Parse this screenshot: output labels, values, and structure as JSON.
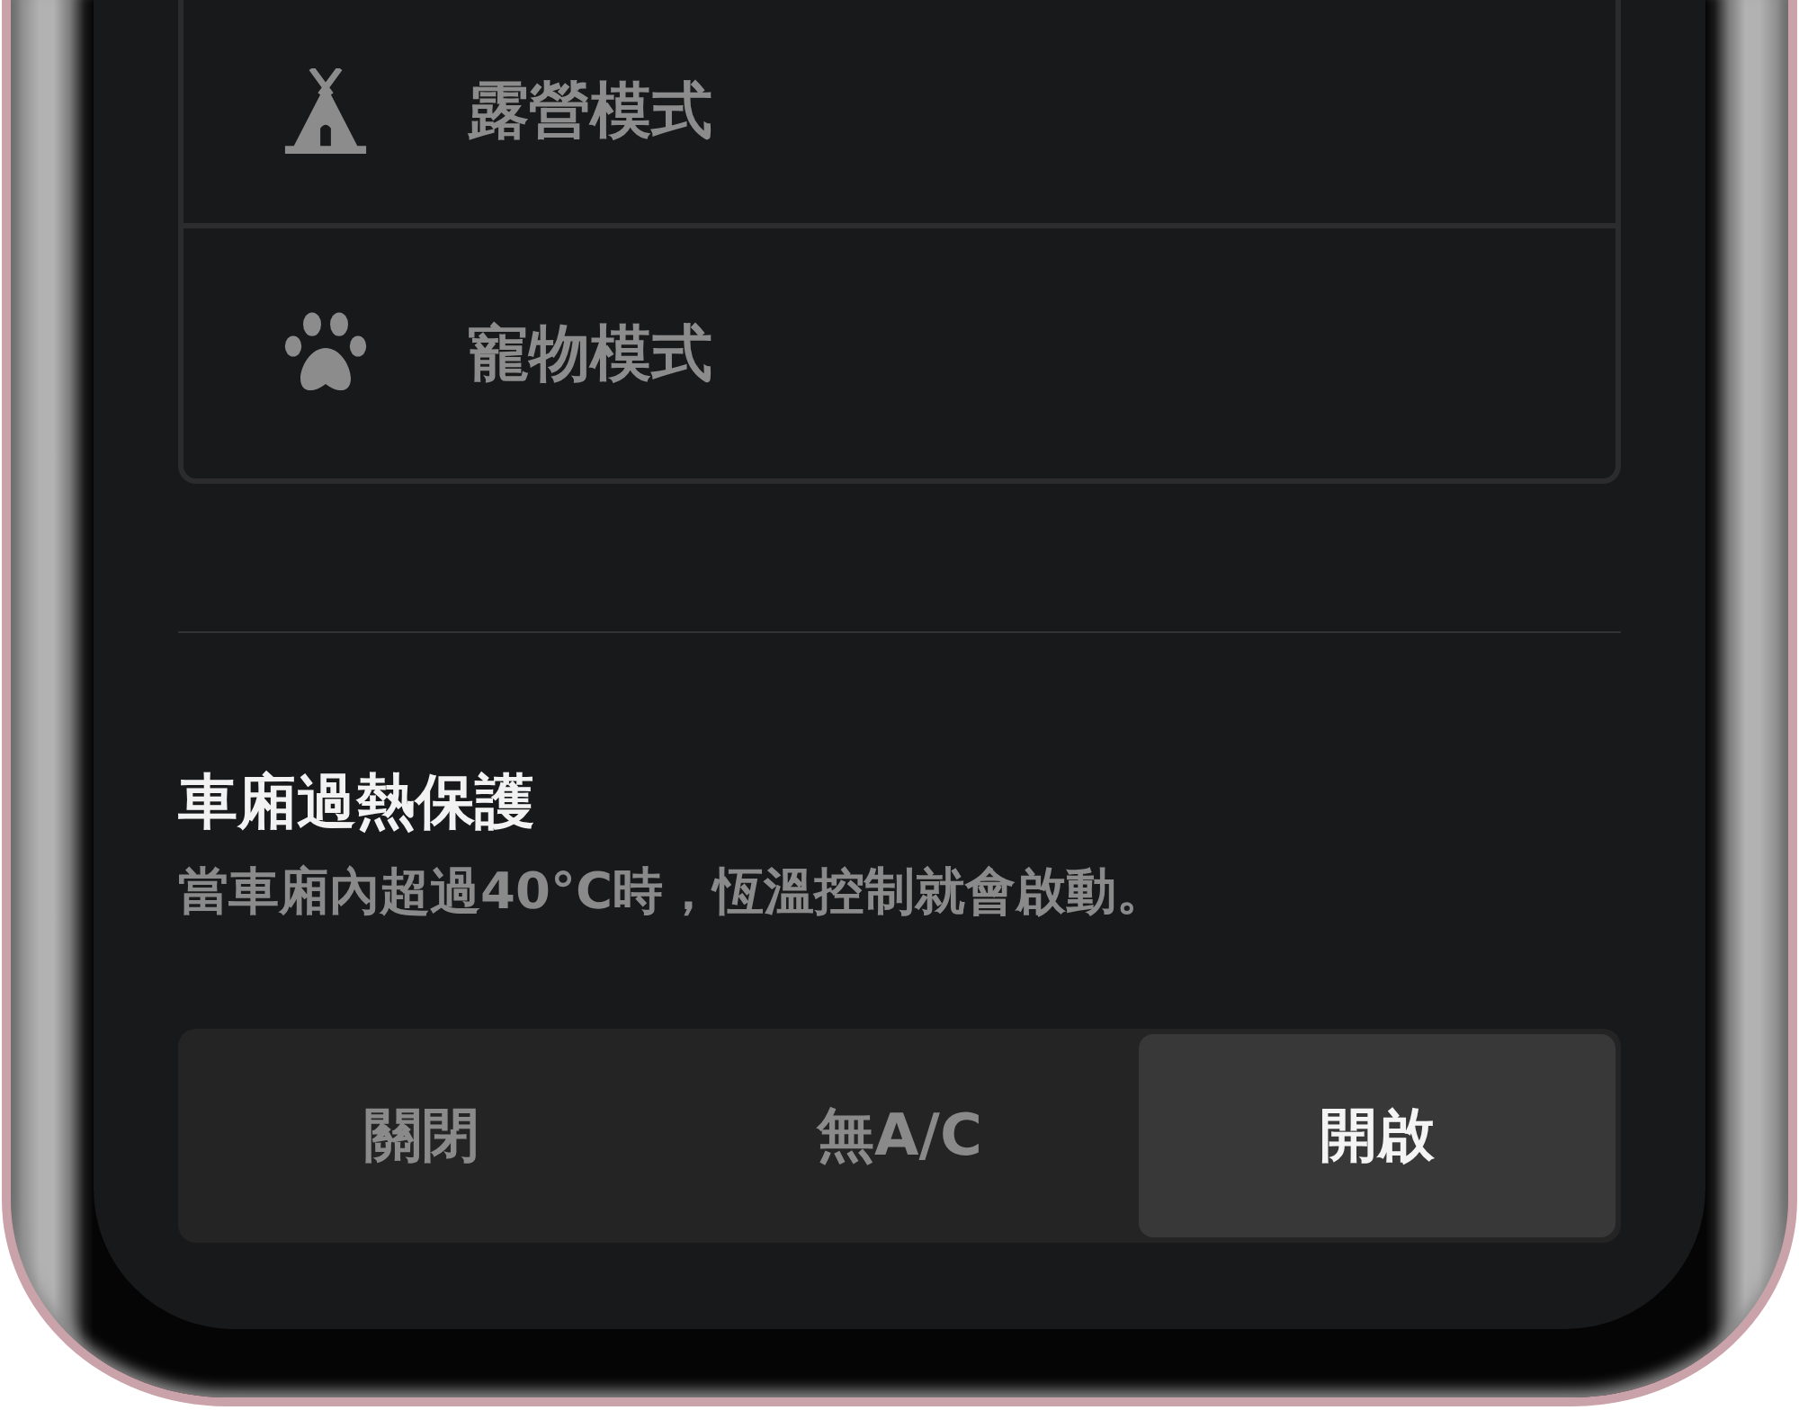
{
  "modes": {
    "items": [
      {
        "kind": "camp",
        "label": "露營模式"
      },
      {
        "kind": "pet",
        "label": "寵物模式"
      }
    ]
  },
  "cabin_overheat_protection": {
    "title": "車廂過熱保護",
    "description": "當車廂內超過40°C時，恆溫控制就會啟動。",
    "options": [
      {
        "label": "關閉",
        "selected": false
      },
      {
        "label": "無A/C",
        "selected": false
      },
      {
        "label": "開啟",
        "selected": true
      }
    ]
  }
}
